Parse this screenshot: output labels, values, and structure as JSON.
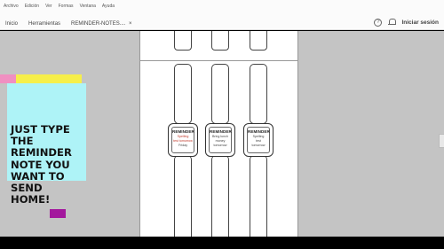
{
  "menu": [
    "Archivo",
    "Edición",
    "Ver",
    "Formas",
    "Ventana",
    "Ayuda"
  ],
  "tabs": {
    "home": "Inicio",
    "tools": "Herramientas",
    "document": "REMINDER-NOTES....",
    "close": "×"
  },
  "header": {
    "help": "?",
    "signin": "Iniciar sesión"
  },
  "note": {
    "text": "JUST TYPE THE REMINDER NOTE YOU WANT TO SEND HOME!"
  },
  "watches": [
    {
      "title": "REMINDER",
      "lines": [
        "Spelling",
        "test tomorrow",
        "Friday"
      ],
      "accent": "#c0392b"
    },
    {
      "title": "REMINDER",
      "lines": [
        "Bring lunch",
        "money",
        "tomorrow"
      ],
      "accent": "#444444"
    },
    {
      "title": "REMINDER",
      "lines": [
        "Spelling",
        "test",
        "tomorrow"
      ],
      "accent": "#444444"
    }
  ],
  "colors": {
    "note_cyan": "#aef3f7",
    "note_pink": "#f08fc1",
    "note_yellow": "#f6ef4a",
    "note_purple": "#a3189d",
    "workspace": "#c4c4c4"
  }
}
